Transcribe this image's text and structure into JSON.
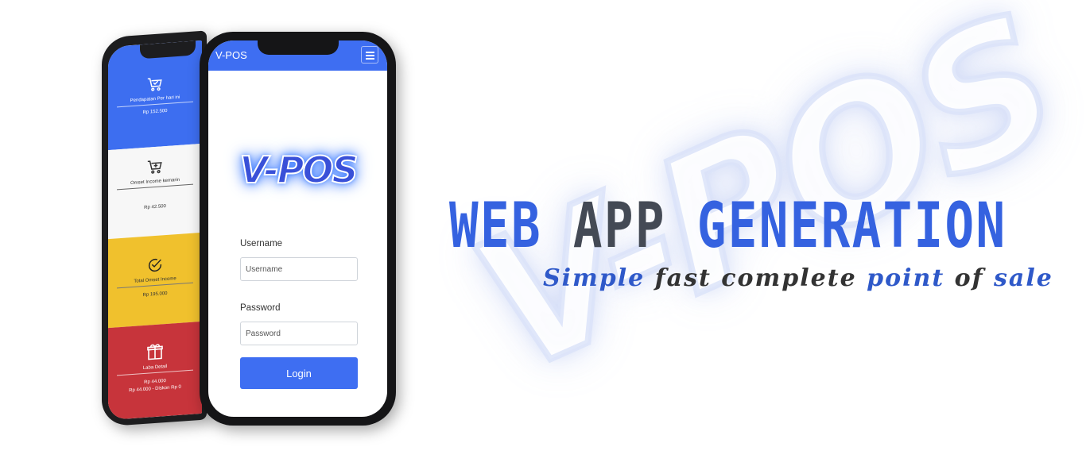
{
  "watermark": {
    "text": "V-POS"
  },
  "headline": {
    "word1": "WEB",
    "word2": "APP",
    "word3": "GENERATION"
  },
  "tagline": {
    "parts": [
      "Simple",
      "fast",
      "complete",
      "point",
      "of",
      "sale"
    ]
  },
  "back_phone": {
    "cards": [
      {
        "label": "Pendapatan Per hari ini",
        "value": "Rp 152.500",
        "icon": "cart-check-icon",
        "color": "#3d6ef0"
      },
      {
        "label": "Omset Income kemarin",
        "value": "Rp 42.500",
        "icon": "cart-plus-icon",
        "color": "#f7f7f7"
      },
      {
        "label": "Total Omset Income",
        "value": "Rp 195.000",
        "icon": "check-circle-icon",
        "color": "#f0c12d"
      },
      {
        "label": "Laba Detail",
        "value": "Rp 44.000",
        "sub": "Rp 44.000 - Diskon Rp 0",
        "icon": "gift-icon",
        "color": "#c7343b"
      }
    ]
  },
  "front_phone": {
    "brand": "V-POS",
    "logo": "V-POS",
    "username_label": "Username",
    "username_placeholder": "Username",
    "password_label": "Password",
    "password_placeholder": "Password",
    "login_label": "Login",
    "accent": "#3e6ef2"
  }
}
